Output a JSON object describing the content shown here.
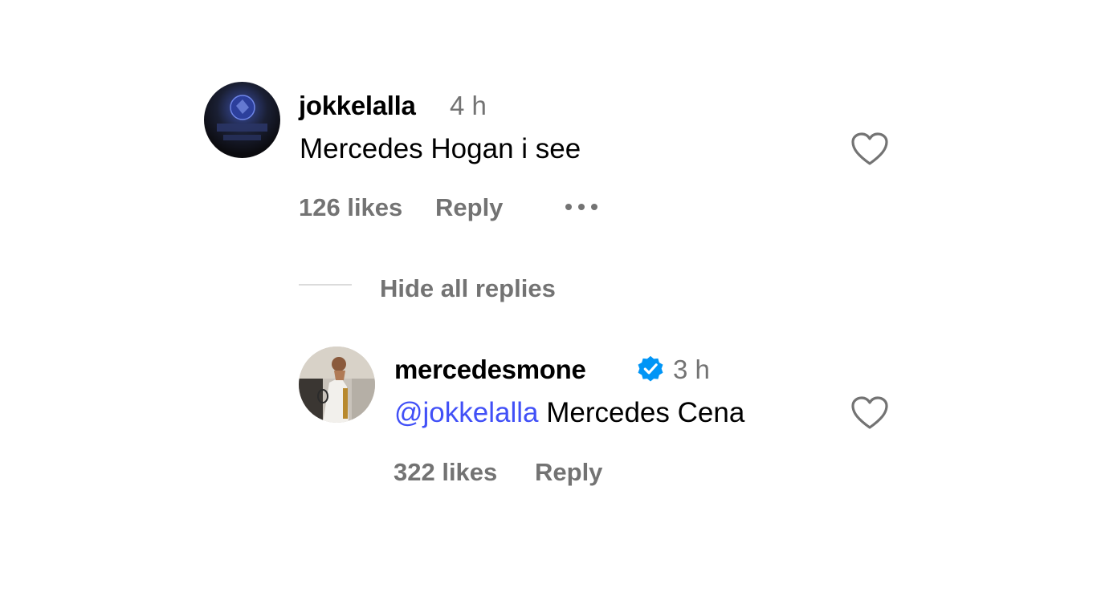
{
  "comment": {
    "username": "jokkelalla",
    "time": "4 h",
    "text": "Mercedes Hogan i see",
    "likes": "126 likes",
    "reply_label": "Reply",
    "more_icon": "more-options-icon",
    "like_icon": "heart-outline-icon"
  },
  "replies_toggle": {
    "label": "Hide all replies"
  },
  "reply": {
    "username": "mercedesmone",
    "verified_icon": "verified-badge-icon",
    "time": "3 h",
    "mention": "@jokkelalla",
    "text": " Mercedes Cena",
    "likes": "322 likes",
    "reply_label": "Reply",
    "like_icon": "heart-outline-icon"
  },
  "colors": {
    "mention": "#4150f7",
    "muted": "#737373",
    "verified": "#0095f6",
    "divider": "#dbdbdb"
  }
}
